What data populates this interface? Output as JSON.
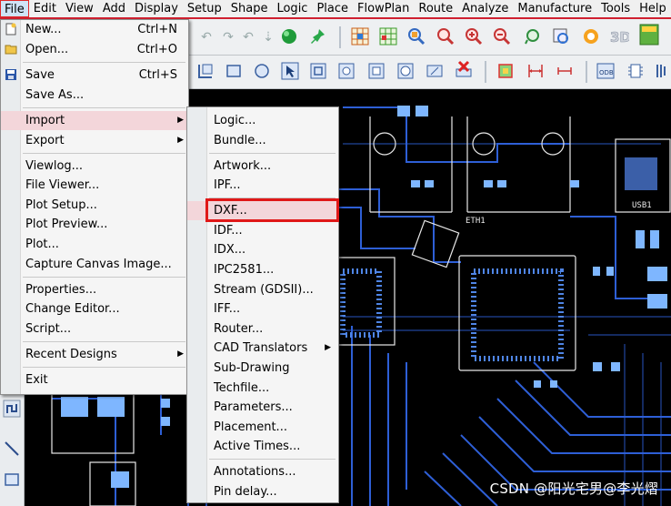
{
  "menubar": {
    "items": [
      "File",
      "Edit",
      "View",
      "Add",
      "Display",
      "Setup",
      "Shape",
      "Logic",
      "Place",
      "FlowPlan",
      "Route",
      "Analyze",
      "Manufacture",
      "Tools",
      "Help"
    ],
    "active": "File"
  },
  "file_menu": {
    "items": [
      {
        "label": "New...",
        "shortcut": "Ctrl+N",
        "icon": "new-file-icon"
      },
      {
        "label": "Open...",
        "shortcut": "Ctrl+O",
        "icon": "open-folder-icon"
      },
      {
        "label": "Save",
        "shortcut": "Ctrl+S",
        "icon": "save-icon"
      },
      {
        "label": "Save As..."
      },
      {
        "label": "Import",
        "has_submenu": true,
        "highlighted": true
      },
      {
        "label": "Export",
        "has_submenu": true
      },
      {
        "label": "Viewlog..."
      },
      {
        "label": "File Viewer..."
      },
      {
        "label": "Plot Setup..."
      },
      {
        "label": "Plot Preview..."
      },
      {
        "label": "Plot..."
      },
      {
        "label": "Capture Canvas Image..."
      },
      {
        "label": "Properties..."
      },
      {
        "label": "Change Editor..."
      },
      {
        "label": "Script..."
      },
      {
        "label": "Recent Designs",
        "has_submenu": true
      },
      {
        "label": "Exit"
      }
    ]
  },
  "import_submenu": {
    "items": [
      {
        "label": "Logic..."
      },
      {
        "label": "Bundle..."
      },
      {
        "label": "Artwork..."
      },
      {
        "label": "IPF..."
      },
      {
        "label": "DXF...",
        "highlighted": true
      },
      {
        "label": "IDF..."
      },
      {
        "label": "IDX..."
      },
      {
        "label": "IPC2581..."
      },
      {
        "label": "Stream (GDSII)..."
      },
      {
        "label": "IFF..."
      },
      {
        "label": "Router..."
      },
      {
        "label": "CAD Translators",
        "has_submenu": true
      },
      {
        "label": "Sub-Drawing"
      },
      {
        "label": "Techfile..."
      },
      {
        "label": "Parameters..."
      },
      {
        "label": "Placement..."
      },
      {
        "label": "Active Times..."
      },
      {
        "label": "Annotations..."
      },
      {
        "label": "Pin delay..."
      }
    ]
  },
  "pcb_labels": {
    "eth": "ETH1",
    "usb": "USB1"
  },
  "watermark": "CSDN @阳光宅男@李光熠",
  "colors": {
    "menu_highlight": "#f3d6da",
    "dxf_box": "#e01818",
    "trace": "#2e5fd6",
    "pad": "#7eb6ff",
    "silkscreen": "#e0e0e0",
    "active_menu_border": "#e02828"
  }
}
